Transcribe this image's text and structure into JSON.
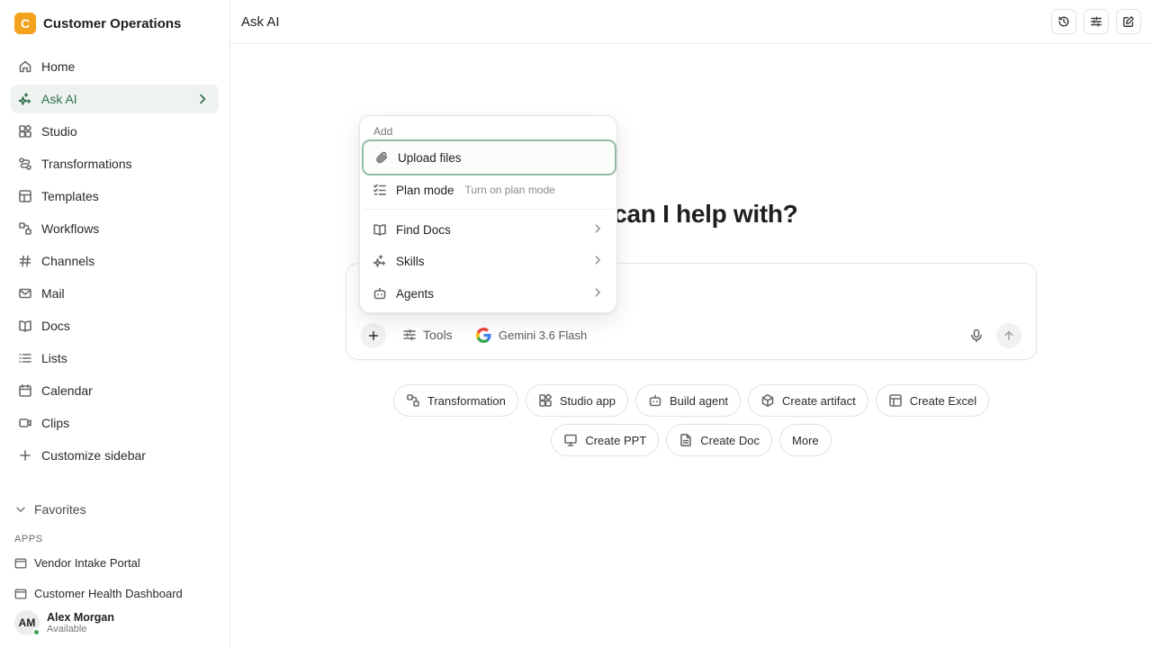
{
  "workspace": {
    "logo_letter": "C",
    "name": "Customer Operations"
  },
  "sidebar": {
    "items": [
      {
        "label": "Home",
        "icon": "home-icon"
      },
      {
        "label": "Ask AI",
        "icon": "sparkle-icon",
        "active": true
      },
      {
        "label": "Studio",
        "icon": "grid-icon"
      },
      {
        "label": "Transformations",
        "icon": "flow-icon"
      },
      {
        "label": "Templates",
        "icon": "template-icon"
      },
      {
        "label": "Workflows",
        "icon": "workflow-icon"
      },
      {
        "label": "Channels",
        "icon": "hash-icon"
      },
      {
        "label": "Mail",
        "icon": "mail-icon"
      },
      {
        "label": "Docs",
        "icon": "book-icon"
      },
      {
        "label": "Lists",
        "icon": "list-icon"
      },
      {
        "label": "Calendar",
        "icon": "calendar-icon"
      },
      {
        "label": "Clips",
        "icon": "video-icon"
      },
      {
        "label": "Customize sidebar",
        "icon": "plus-icon"
      }
    ],
    "favorites_label": "Favorites",
    "apps_header": "APPS",
    "apps": [
      {
        "label": "Vendor Intake Portal",
        "icon": "app-window-icon"
      },
      {
        "label": "Customer Health Dashboard",
        "icon": "app-window-icon"
      }
    ],
    "user": {
      "initials": "AM",
      "name": "Alex Morgan",
      "status": "Available",
      "status_color": "#3aa55d"
    }
  },
  "header": {
    "title": "Ask AI"
  },
  "main": {
    "hero_text": "at can I help with?",
    "composer": {
      "tools_label": "Tools",
      "model_label": "Gemini 3.6 Flash"
    },
    "chips_row1": [
      {
        "label": "Transformation",
        "icon": "flow-icon"
      },
      {
        "label": "Studio app",
        "icon": "grid-icon"
      },
      {
        "label": "Build agent",
        "icon": "bot-icon"
      },
      {
        "label": "Create artifact",
        "icon": "cube-icon"
      },
      {
        "label": "Create Excel",
        "icon": "table-icon"
      }
    ],
    "chips_row2": [
      {
        "label": "Create PPT",
        "icon": "presentation-icon"
      },
      {
        "label": "Create Doc",
        "icon": "document-icon"
      },
      {
        "label": "More",
        "icon": ""
      }
    ]
  },
  "menu": {
    "header": "Add",
    "upload_label": "Upload files",
    "plan_label": "Plan mode",
    "plan_sub": "Turn on plan mode",
    "find_docs_label": "Find Docs",
    "skills_label": "Skills",
    "agents_label": "Agents"
  },
  "colors": {
    "accent": "#2f6f4d",
    "active_bg": "#eef3ef",
    "logo": "#f2a21c",
    "focus_border": "#93bba2"
  }
}
